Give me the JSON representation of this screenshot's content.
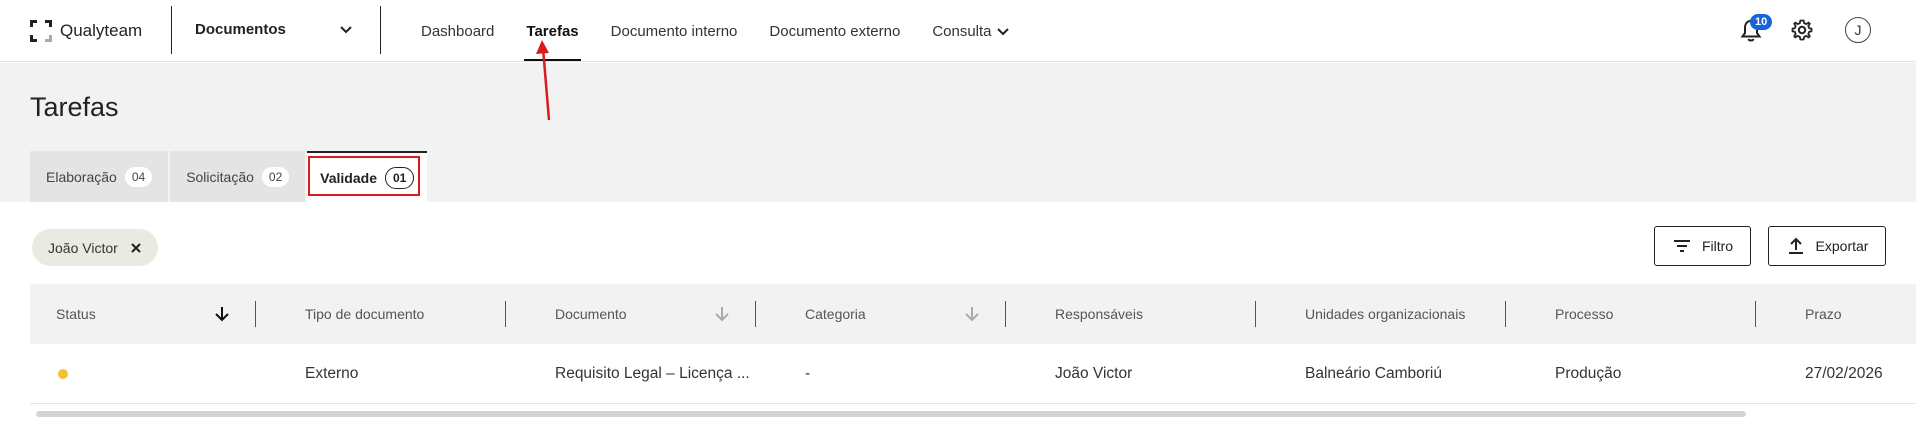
{
  "app": {
    "logo_text": "Qualyteam"
  },
  "module": {
    "selected": "Documentos"
  },
  "nav": {
    "items": [
      {
        "label": "Dashboard"
      },
      {
        "label": "Tarefas"
      },
      {
        "label": "Documento interno"
      },
      {
        "label": "Documento externo"
      },
      {
        "label": "Consulta"
      }
    ]
  },
  "topbar": {
    "notifications_count": "10",
    "avatar_initial": "J"
  },
  "page": {
    "title": "Tarefas"
  },
  "tabs": [
    {
      "label": "Elaboração",
      "count": "04"
    },
    {
      "label": "Solicitação",
      "count": "02"
    },
    {
      "label": "Validade",
      "count": "01"
    }
  ],
  "filters": {
    "chip_label": "João Victor"
  },
  "actions": {
    "filter_label": "Filtro",
    "export_label": "Exportar"
  },
  "table": {
    "columns": [
      {
        "label": "Status"
      },
      {
        "label": "Tipo de documento"
      },
      {
        "label": "Documento"
      },
      {
        "label": "Categoria"
      },
      {
        "label": "Responsáveis"
      },
      {
        "label": "Unidades organizacionais"
      },
      {
        "label": "Processo"
      },
      {
        "label": "Prazo"
      }
    ],
    "rows": [
      {
        "status_color": "#f2c12e",
        "tipo": "Externo",
        "documento": "Requisito Legal – Licença ...",
        "categoria": "-",
        "responsaveis": "João Victor",
        "unidades": "Balneário Camboriú",
        "processo": "Produção",
        "prazo": "27/02/2026"
      }
    ]
  },
  "colors": {
    "accent_badge": "#1565d8",
    "annotation": "#d81b1b",
    "status_pending": "#f2c12e"
  }
}
